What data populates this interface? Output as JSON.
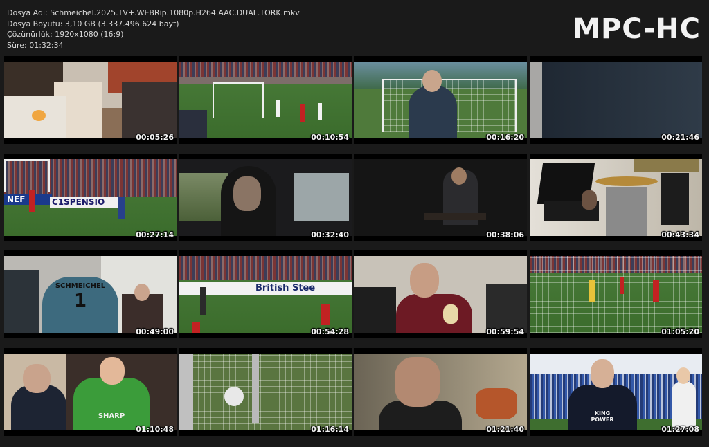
{
  "info": {
    "file_name": "Dosya Adı: Schmeichel.2025.TV+.WEBRip.1080p.H264.AAC.DUAL.TORK.mkv",
    "file_size": "Dosya Boyutu: 3,10 GB (3.337.496.624 bayt)",
    "resolution": "Çözünürlük: 1920x1080 (16:9)",
    "duration": "Süre: 01:32:34"
  },
  "logo": "MPC-HC",
  "thumbnails": [
    {
      "timestamp": "00:05:26",
      "scene": "home-interior-family"
    },
    {
      "timestamp": "00:10:54",
      "scene": "stadium-football-match"
    },
    {
      "timestamp": "00:16:20",
      "scene": "man-in-front-of-goal"
    },
    {
      "timestamp": "00:21:46",
      "scene": "dark-closeup"
    },
    {
      "timestamp": "00:27:14",
      "scene": "goalkeeper-in-stadium"
    },
    {
      "timestamp": "00:32:40",
      "scene": "man-in-car"
    },
    {
      "timestamp": "00:38:06",
      "scene": "man-seated-dark-room"
    },
    {
      "timestamp": "00:43:34",
      "scene": "piano-and-drums-room"
    },
    {
      "timestamp": "00:49:00",
      "scene": "locker-room-jersey"
    },
    {
      "timestamp": "00:54:28",
      "scene": "goal-save-british-steel"
    },
    {
      "timestamp": "00:59:54",
      "scene": "man-on-airplane"
    },
    {
      "timestamp": "01:05:20",
      "scene": "match-through-net"
    },
    {
      "timestamp": "01:10:48",
      "scene": "goalkeeper-and-suited-man"
    },
    {
      "timestamp": "01:16:14",
      "scene": "ball-in-net"
    },
    {
      "timestamp": "01:21:40",
      "scene": "older-man-portrait"
    },
    {
      "timestamp": "01:27:08",
      "scene": "celebration-with-medal"
    }
  ],
  "overlay_text": {
    "banner_nef": "NEF",
    "banner_spensio": "C1SPENSIO",
    "banner_british_steel": "British Stee",
    "jersey_name": "SCHMEICHEL",
    "jersey_number": "1",
    "sponsor_sharp": "SHARP",
    "sponsor_king_power": "KING POWER"
  },
  "colors": {
    "background": "#1a1a1a",
    "text": "#d8d8d8",
    "logo": "#f2f2f2"
  }
}
